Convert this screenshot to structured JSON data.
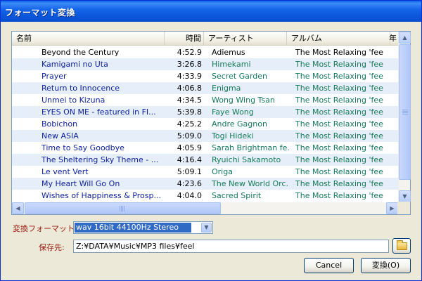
{
  "window": {
    "title": "フォーマット変換"
  },
  "columns": {
    "name": "名前",
    "time": "時間",
    "artist": "アーティスト",
    "album": "アルバム",
    "year": "年"
  },
  "tracks": [
    {
      "name": "Beyond the Century",
      "time": "4:52.9",
      "artist": "Adiemus",
      "album": "The Most Relaxing 'feel'"
    },
    {
      "name": "Kamigami no Uta",
      "time": "3:26.8",
      "artist": "Himekami",
      "album": "The Most Relaxing 'feel'"
    },
    {
      "name": "Prayer",
      "time": "4:33.9",
      "artist": "Secret Garden",
      "album": "The Most Relaxing 'feel'"
    },
    {
      "name": "Return to Innocence",
      "time": "4:06.8",
      "artist": "Enigma",
      "album": "The Most Relaxing 'feel'"
    },
    {
      "name": "Unmei to Kizuna",
      "time": "4:34.5",
      "artist": "Wong Wing Tsan",
      "album": "The Most Relaxing 'feel'"
    },
    {
      "name": "EYES ON ME - featured in FI...",
      "time": "5:39.8",
      "artist": "Faye Wong",
      "album": "The Most Relaxing 'feel'"
    },
    {
      "name": "Bobichon",
      "time": "4:25.2",
      "artist": "Andre Gagnon",
      "album": "The Most Relaxing 'feel'"
    },
    {
      "name": "New ASIA",
      "time": "5:09.0",
      "artist": "Togi Hideki",
      "album": "The Most Relaxing 'feel'"
    },
    {
      "name": "Time to Say Goodbye",
      "time": "4:05.9",
      "artist": "Sarah Brightman fe...",
      "album": "The Most Relaxing 'feel'"
    },
    {
      "name": "The Sheltering Sky Theme - ...",
      "time": "4:16.4",
      "artist": "Ryuichi Sakamoto",
      "album": "The Most Relaxing 'feel'"
    },
    {
      "name": "Le vent Vert",
      "time": "5:09.1",
      "artist": "Origa",
      "album": "The Most Relaxing 'feel'"
    },
    {
      "name": "My Heart Will Go On",
      "time": "4:23.6",
      "artist": "The New World Orc...",
      "album": "The Most Relaxing 'feel'"
    },
    {
      "name": "Wishes of Happiness & Prosp...",
      "time": "4:04.0",
      "artist": "Sacred Spirit",
      "album": "The Most Relaxing 'feel'"
    }
  ],
  "form": {
    "format_label": "変換フォーマット:",
    "format_value": "wav 16bit 44100Hz Stereo",
    "save_label": "保存先:",
    "save_path": "Z:¥DATA¥Music¥MP3 files¥feel"
  },
  "buttons": {
    "cancel": "Cancel",
    "convert": "変換(O)"
  },
  "colors": {
    "title_bar": "#0a5fe6",
    "selection": "#316ac5",
    "track_name": "#0b1f9e",
    "artist_album": "#137a55",
    "label": "#9b1c12",
    "alt_row": "#e6eef9"
  }
}
